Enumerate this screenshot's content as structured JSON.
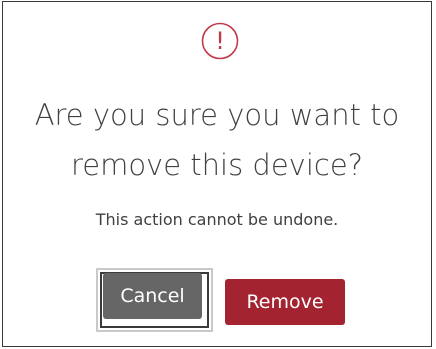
{
  "dialog": {
    "icon": "exclamation-circle-icon",
    "icon_glyph": "!",
    "title_line1": "Are you sure you want to",
    "title_line2": "remove this device?",
    "message": "This action cannot be undone.",
    "cancel_label": "Cancel",
    "remove_label": "Remove"
  },
  "colors": {
    "warning": "#c0394a",
    "cancel_bg": "#666666",
    "remove_bg": "#a32430",
    "text": "#404040"
  }
}
